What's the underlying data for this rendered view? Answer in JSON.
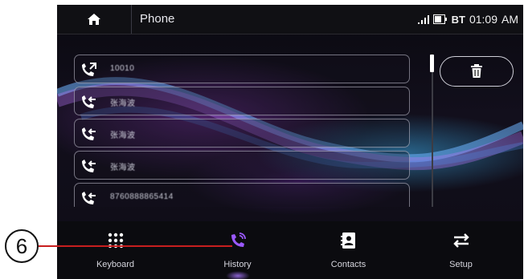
{
  "header": {
    "title": "Phone",
    "bt_label": "BT",
    "time": "01:09",
    "ampm": "AM",
    "home_icon": "home-icon",
    "signal_icon": "signal-icon",
    "battery_icon": "battery-icon"
  },
  "history": {
    "entries": [
      {
        "type": "outgoing",
        "icon": "outgoing-call-icon",
        "number": "10010"
      },
      {
        "type": "incoming",
        "icon": "incoming-call-icon",
        "number": "张海波"
      },
      {
        "type": "incoming",
        "icon": "incoming-call-icon",
        "number": "张海波"
      },
      {
        "type": "incoming",
        "icon": "incoming-call-icon",
        "number": "张海波"
      },
      {
        "type": "incoming",
        "icon": "incoming-call-icon",
        "number": "8760888865414"
      }
    ],
    "delete_icon": "trash-icon"
  },
  "tabs": [
    {
      "label": "Keyboard",
      "icon": "keypad-icon"
    },
    {
      "label": "History",
      "icon": "call-history-icon",
      "active": true
    },
    {
      "label": "Contacts",
      "icon": "contacts-icon"
    },
    {
      "label": "Setup",
      "icon": "setup-icon"
    }
  ],
  "callout": {
    "number": "6",
    "color": "#c81e1e"
  },
  "colors": {
    "accent": "#9b59ff",
    "icon": "#ffffff"
  }
}
